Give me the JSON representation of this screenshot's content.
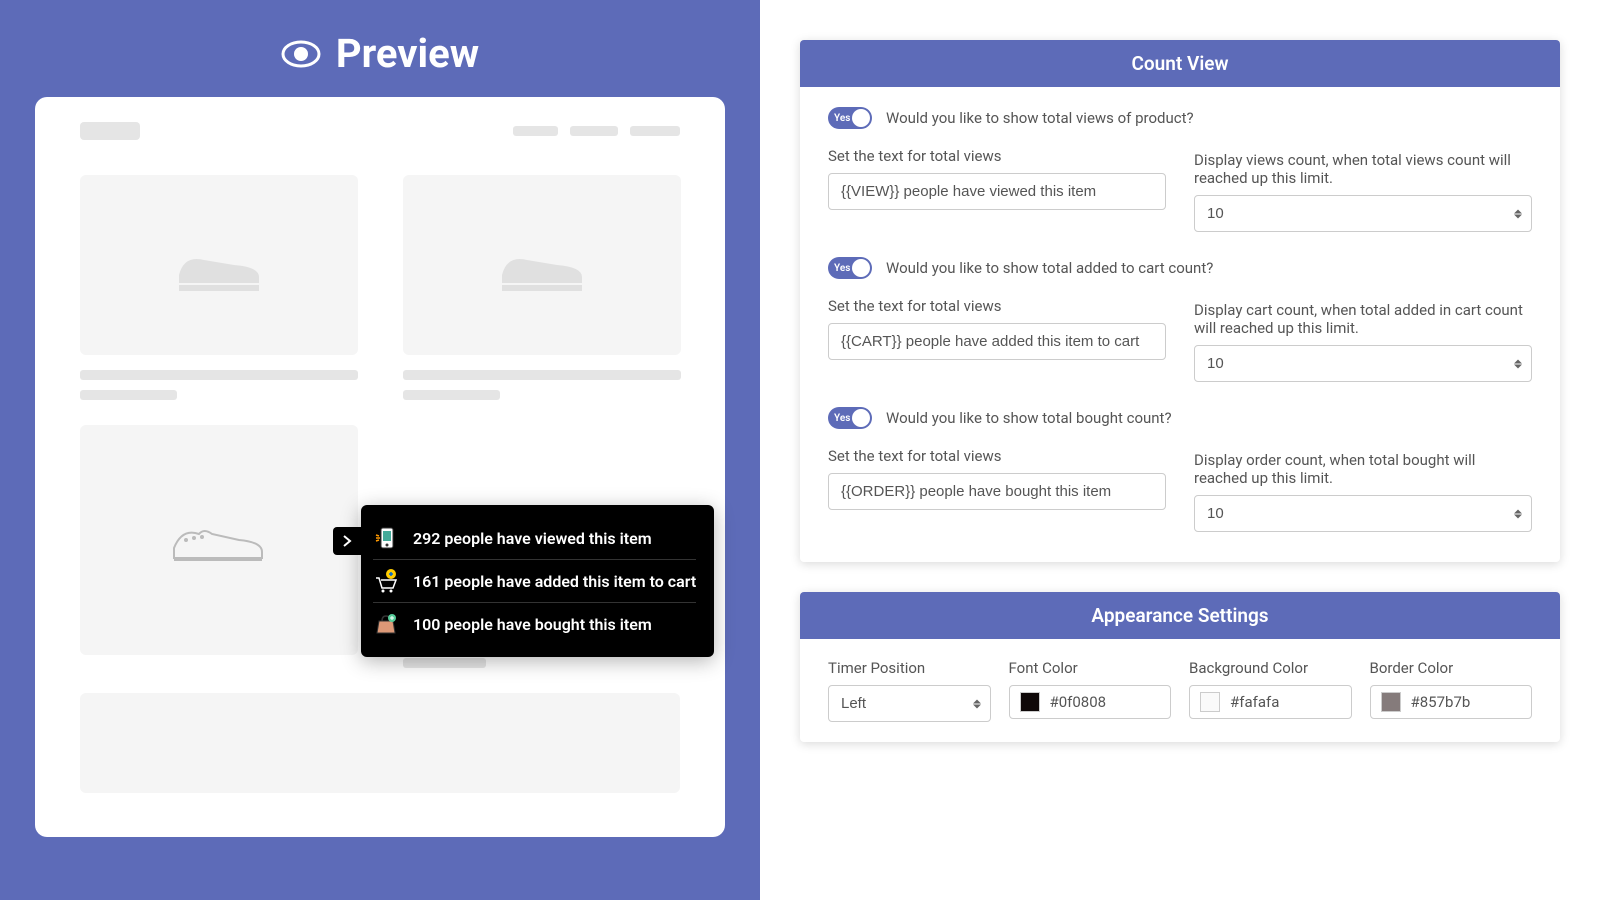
{
  "preview": {
    "title": "Preview",
    "tooltip": {
      "views": "292 people have viewed this item",
      "cart": "161 people have added this item to cart",
      "bought": "100 people have bought this item"
    }
  },
  "count_view": {
    "header": "Count View",
    "toggle_yes": "Yes",
    "views": {
      "toggle_label": "Would you like to show total views of product?",
      "text_label": "Set the text for total views",
      "text_value": "{{VIEW}} people have viewed this item",
      "limit_label": "Display views count, when total views count will reached up this limit.",
      "limit_value": "10"
    },
    "cart": {
      "toggle_label": "Would you like to show total added to cart count?",
      "text_label": "Set the text for total views",
      "text_value": "{{CART}} people have added this item to cart",
      "limit_label": "Display cart count, when total added in cart count will reached up this limit.",
      "limit_value": "10"
    },
    "bought": {
      "toggle_label": "Would you like to show total bought count?",
      "text_label": "Set the text for total views",
      "text_value": "{{ORDER}} people have bought this item",
      "limit_label": "Display order count, when total bought will reached up this limit.",
      "limit_value": "10"
    }
  },
  "appearance": {
    "header": "Appearance Settings",
    "timer_position_label": "Timer Position",
    "timer_position_value": "Left",
    "font_color_label": "Font Color",
    "font_color_value": "#0f0808",
    "bg_color_label": "Background Color",
    "bg_color_value": "#fafafa",
    "border_color_label": "Border Color",
    "border_color_value": "#857b7b"
  }
}
